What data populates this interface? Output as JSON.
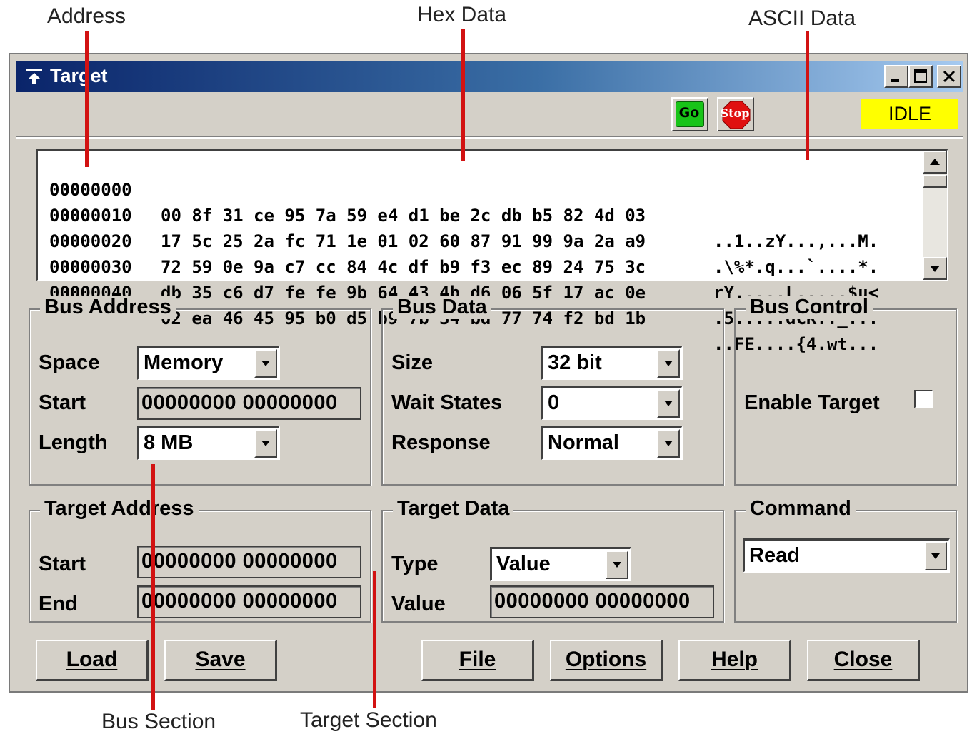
{
  "callouts": {
    "address": "Address",
    "hex_data": "Hex Data",
    "ascii_data": "ASCII Data",
    "bus_section": "Bus Section",
    "target_section": "Target Section"
  },
  "window": {
    "title": "Target",
    "go_label": "Go",
    "stop_label": "Stop",
    "status": "IDLE"
  },
  "hex": {
    "rows": [
      {
        "address": "00000000",
        "bytes": "00 8f 31 ce 95 7a 59 e4 d1 be 2c db b5 82 4d 03",
        "ascii": "..1..zY...,...M."
      },
      {
        "address": "00000010",
        "bytes": "17 5c 25 2a fc 71 1e 01 02 60 87 91 99 9a 2a a9",
        "ascii": ".\\%*.q...`....*."
      },
      {
        "address": "00000020",
        "bytes": "72 59 0e 9a c7 cc 84 4c df b9 f3 ec 89 24 75 3c",
        "ascii": "rY.....L.....$u<"
      },
      {
        "address": "00000030",
        "bytes": "db 35 c6 d7 fe fe 9b 64 43 4b d6 06 5f 17 ac 0e",
        "ascii": ".5.....dCK.._..."
      },
      {
        "address": "00000040",
        "bytes": "02 ea 46 45 95 b0 d5 b9 7b 34 bd 77 74 f2 bd 1b",
        "ascii": "..FE....{4.wt..."
      }
    ]
  },
  "bus_address": {
    "title": "Bus Address",
    "space_label": "Space",
    "space_value": "Memory",
    "start_label": "Start",
    "start_value": "00000000 00000000",
    "length_label": "Length",
    "length_value": "8 MB"
  },
  "bus_data": {
    "title": "Bus Data",
    "size_label": "Size",
    "size_value": "32 bit",
    "wait_label": "Wait States",
    "wait_value": "0",
    "response_label": "Response",
    "response_value": "Normal"
  },
  "bus_control": {
    "title": "Bus Control",
    "enable_label": "Enable Target",
    "enable_checked": false
  },
  "target_address": {
    "title": "Target Address",
    "start_label": "Start",
    "start_value": "00000000 00000000",
    "end_label": "End",
    "end_value": "00000000 00000000"
  },
  "target_data": {
    "title": "Target Data",
    "type_label": "Type",
    "type_value": "Value",
    "value_label": "Value",
    "value_value": "00000000 00000000"
  },
  "command": {
    "title": "Command",
    "value": "Read"
  },
  "buttons": {
    "load": "Load",
    "save": "Save",
    "file": "File",
    "options": "Options",
    "help": "Help",
    "close": "Close"
  },
  "colors": {
    "titlebar_start": "#0a246a",
    "status_bg": "#ffff00",
    "go": "#18c418",
    "stop": "#e01010",
    "callout_line": "#d21212"
  }
}
